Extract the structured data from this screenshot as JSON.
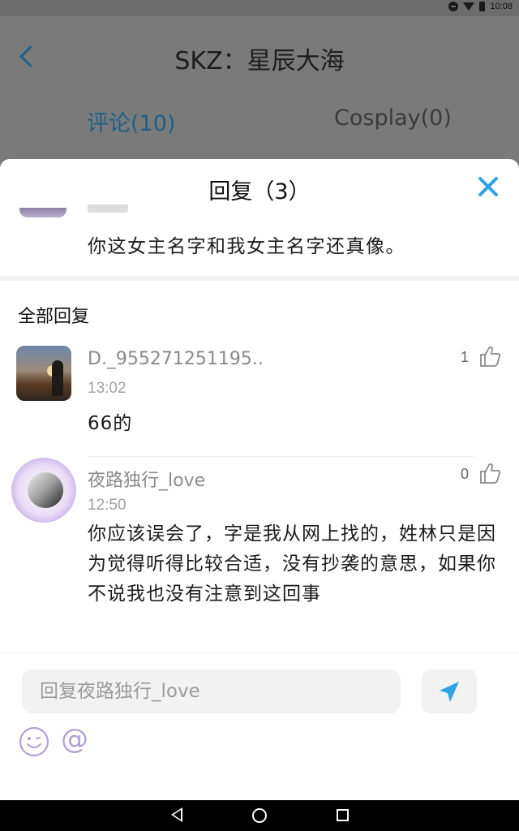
{
  "status_bar": {
    "time": "10:08"
  },
  "background_page": {
    "title": "SKZ：星辰大海",
    "tabs": [
      {
        "label": "评论(10)",
        "active": true
      },
      {
        "label": "Cosplay(0)",
        "active": false
      }
    ]
  },
  "reply_sheet": {
    "title": "回复（3）",
    "original_comment": {
      "text": "你这女主名字和我女主名字还真像。"
    },
    "section_title": "全部回复",
    "replies": [
      {
        "username": "D._955271251195..",
        "time": "13:02",
        "likes": "1",
        "text": "66的"
      },
      {
        "username": "夜路独行_love",
        "time": "12:50",
        "likes": "0",
        "text": "你应该误会了，字是我从网上找的，姓林只是因为觉得听得比较合适，没有抄袭的意思，如果你不说我也没有注意到这回事"
      }
    ],
    "input": {
      "placeholder": "回复夜路独行_love",
      "value": ""
    },
    "accent_color": "#2ea3e7"
  },
  "icons": {
    "back": "chevron-left-icon",
    "close": "close-icon",
    "like": "thumbs-up-icon",
    "send": "paper-plane-icon",
    "emoji": "smiley-icon",
    "mention": "at-icon"
  }
}
